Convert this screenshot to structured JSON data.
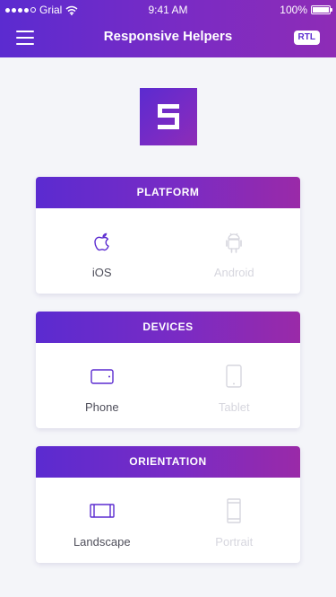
{
  "status": {
    "carrier": "Grial",
    "time": "9:41 AM",
    "battery": "100%"
  },
  "nav": {
    "title": "Responsive Helpers",
    "rtl_label": "RTL"
  },
  "colors": {
    "accent": "#5b2bd0",
    "accent_end": "#8e2cb6",
    "inactive": "#d6d6de"
  },
  "cards": [
    {
      "title": "PLATFORM",
      "options": [
        {
          "label": "iOS",
          "icon": "apple-icon",
          "active": true
        },
        {
          "label": "Android",
          "icon": "android-icon",
          "active": false
        }
      ]
    },
    {
      "title": "DEVICES",
      "options": [
        {
          "label": "Phone",
          "icon": "phone-icon",
          "active": true
        },
        {
          "label": "Tablet",
          "icon": "tablet-icon",
          "active": false
        }
      ]
    },
    {
      "title": "ORIENTATION",
      "options": [
        {
          "label": "Landscape",
          "icon": "landscape-icon",
          "active": true
        },
        {
          "label": "Portrait",
          "icon": "portrait-icon",
          "active": false
        }
      ]
    }
  ]
}
